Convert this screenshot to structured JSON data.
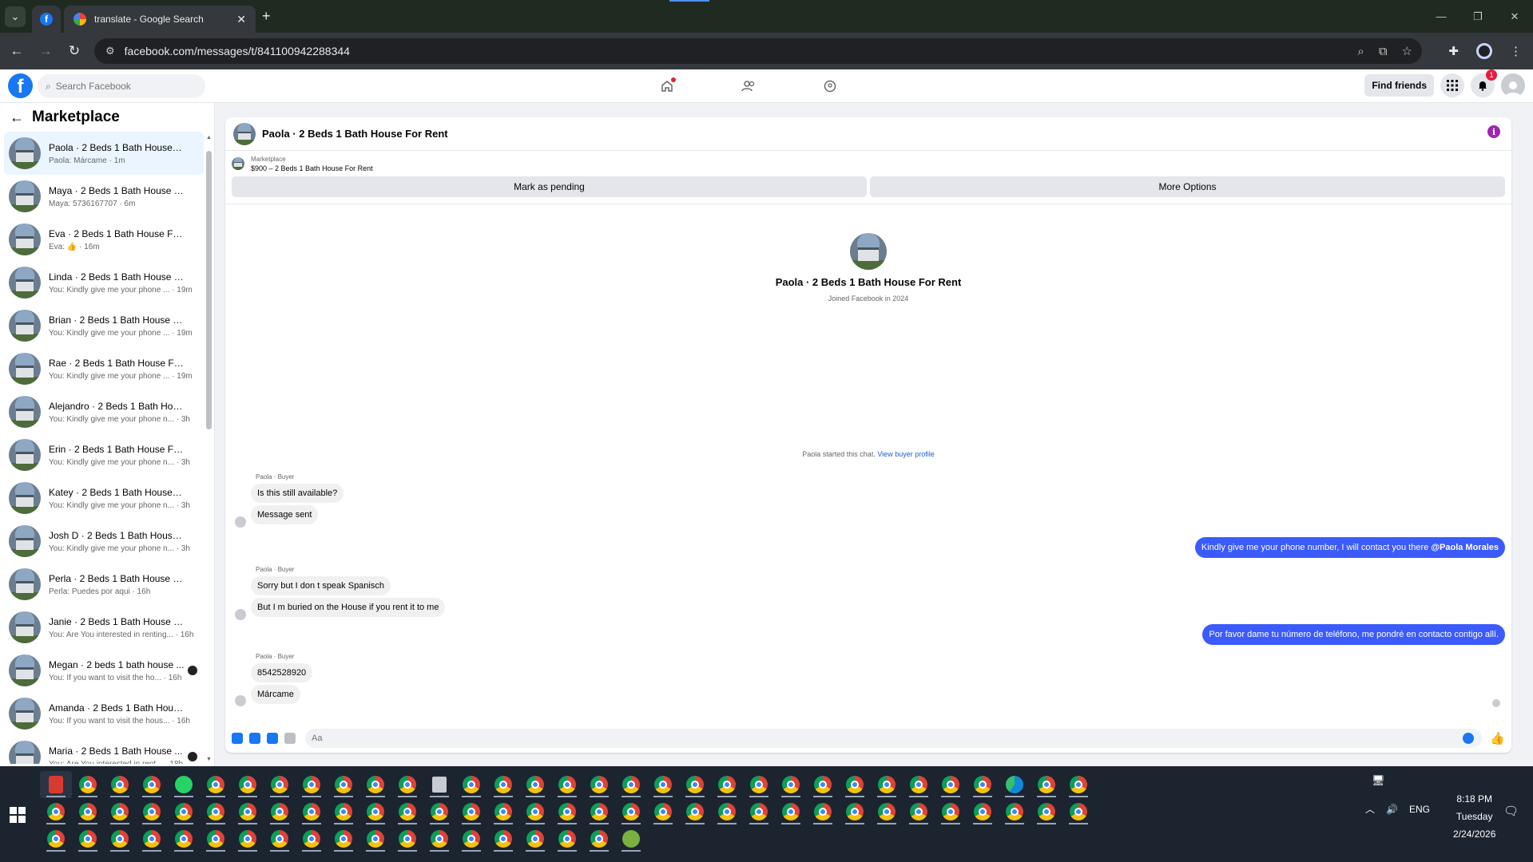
{
  "browser": {
    "active_tab_title": "translate - Google Search",
    "url": "facebook.com/messages/t/841100942288344"
  },
  "fb_header": {
    "search_placeholder": "Search Facebook",
    "find_friends": "Find friends",
    "notification_count": "1"
  },
  "sidebar": {
    "title": "Marketplace",
    "conversations": [
      {
        "name": "Paola · 2 Beds 1 Bath House For...",
        "snippet": "Paola: Márcame · 1m",
        "active": true
      },
      {
        "name": "Maya · 2 Beds 1 Bath House For...",
        "snippet": "Maya: 5736167707 · 6m"
      },
      {
        "name": "Eva · 2 Beds 1 Bath House For R...",
        "snippet": "Eva: 👍 · 16m"
      },
      {
        "name": "Linda · 2 Beds 1 Bath House For...",
        "snippet": "You: Kindly give me your phone ... · 19m"
      },
      {
        "name": "Brian · 2 Beds 1 Bath House For ...",
        "snippet": "You: Kindly give me your phone ... · 19m"
      },
      {
        "name": "Rae · 2 Beds 1 Bath House For R...",
        "snippet": "You: Kindly give me your phone ... · 19m"
      },
      {
        "name": "Alejandro · 2 Beds 1 Bath House...",
        "snippet": "You: Kindly give me your phone n... · 3h"
      },
      {
        "name": "Erin · 2 Beds 1 Bath House For R...",
        "snippet": "You: Kindly give me your phone n... · 3h"
      },
      {
        "name": "Katey · 2 Beds 1 Bath House For...",
        "snippet": "You: Kindly give me your phone n... · 3h"
      },
      {
        "name": "Josh D · 2 Beds 1 Bath House Fo...",
        "snippet": "You: Kindly give me your phone n... · 3h"
      },
      {
        "name": "Perla · 2 Beds 1 Bath House For ...",
        "snippet": "Perla: Puedes por aqui · 16h"
      },
      {
        "name": "Janie · 2 Beds 1 Bath House For ...",
        "snippet": "You: Are You interested in renting... · 16h"
      },
      {
        "name": "Megan · 2 beds 1 bath house ...",
        "snippet": "You: If you want to visit the ho... · 16h"
      },
      {
        "name": "Amanda · 2 Beds 1 Bath House ...",
        "snippet": "You: If you want to visit the hous... · 16h"
      },
      {
        "name": "Maria · 2 Beds 1 Bath House ...",
        "snippet": "You: Are You interested in rent... · 18h"
      }
    ]
  },
  "chat": {
    "title": "Paola · 2 Beds 1 Bath House For Rent",
    "listing_label": "Marketplace",
    "listing_price": "$900 – 2 Beds 1 Bath House For Rent",
    "mark_pending": "Mark as pending",
    "more_options": "More Options",
    "profile_name": "Paola · 2 Beds 1 Bath House For Rent",
    "profile_sub": "Joined Facebook in 2024",
    "started_text": "Paola started this chat.",
    "view_buyer": "View buyer profile",
    "sender_label": "Paola · Buyer",
    "msg_1": "Is this still available?",
    "msg_2": "Message sent",
    "out_1": "Kindly give me your phone number, I will contact you there",
    "out_1_mention": "@Paola Morales",
    "msg_3": "Sorry  but I don  t speak Spanisch",
    "msg_4": "But I m buried on the House if you rent it to me",
    "out_2": "Por favor dame tu número de teléfono, me pondré en contacto contigo allí.",
    "msg_5": "8542528920",
    "msg_6": "Márcame",
    "composer_placeholder": "Aa"
  },
  "taskbar": {
    "time": "8:18 PM",
    "day": "Tuesday",
    "date": "2/24/2026",
    "lang": "ENG"
  }
}
